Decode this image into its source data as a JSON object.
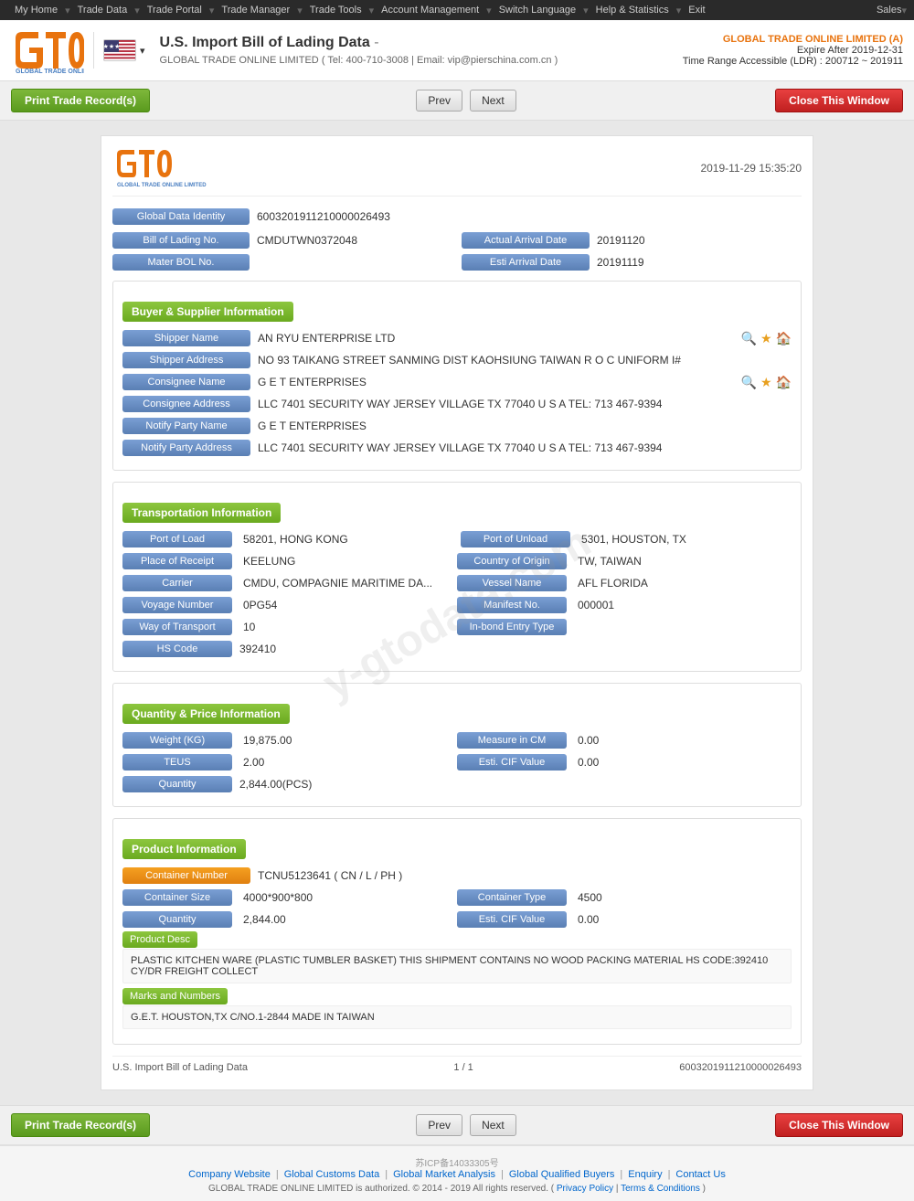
{
  "nav": {
    "items": [
      "My Home",
      "Trade Data",
      "Trade Portal",
      "Trade Manager",
      "Trade Tools",
      "Account Management",
      "Switch Language",
      "Help & Statistics",
      "Exit"
    ],
    "sales": "Sales"
  },
  "header": {
    "title": "U.S. Import Bill of Lading Data",
    "subtitle_company": "GLOBAL TRADE ONLINE LIMITED",
    "subtitle_tel": "Tel: 400-710-3008",
    "subtitle_email": "Email: vip@pierschina.com.cn",
    "company_name": "GLOBAL TRADE ONLINE LIMITED (A)",
    "expire": "Expire After 2019-12-31",
    "ldr": "Time Range Accessible (LDR) : 200712 ~ 201911"
  },
  "actions": {
    "print": "Print Trade Record(s)",
    "prev": "Prev",
    "next": "Next",
    "close": "Close This Window"
  },
  "doc": {
    "date": "2019-11-29 15:35:20",
    "global_data_label": "Global Data Identity",
    "global_data_value": "6003201911210000026493",
    "bol_label": "Bill of Lading No.",
    "bol_value": "CMDUTWN0372048",
    "arrival_date_label": "Actual Arrival Date",
    "arrival_date_value": "20191120",
    "master_bol_label": "Mater BOL No.",
    "master_bol_value": "",
    "esti_arrival_label": "Esti Arrival Date",
    "esti_arrival_value": "20191119"
  },
  "buyer_supplier": {
    "title": "Buyer & Supplier Information",
    "shipper_name_label": "Shipper Name",
    "shipper_name_value": "AN RYU ENTERPRISE LTD",
    "shipper_addr_label": "Shipper Address",
    "shipper_addr_value": "NO 93 TAIKANG STREET SANMING DIST KAOHSIUNG TAIWAN R O C UNIFORM I#",
    "consignee_name_label": "Consignee Name",
    "consignee_name_value": "G E T ENTERPRISES",
    "consignee_addr_label": "Consignee Address",
    "consignee_addr_value": "LLC 7401 SECURITY WAY JERSEY VILLAGE TX 77040 U S A TEL: 713 467-9394",
    "notify_party_name_label": "Notify Party Name",
    "notify_party_name_value": "G E T ENTERPRISES",
    "notify_party_addr_label": "Notify Party Address",
    "notify_party_addr_value": "LLC 7401 SECURITY WAY JERSEY VILLAGE TX 77040 U S A TEL: 713 467-9394"
  },
  "transportation": {
    "title": "Transportation Information",
    "port_load_label": "Port of Load",
    "port_load_value": "58201, HONG KONG",
    "port_unload_label": "Port of Unload",
    "port_unload_value": "5301, HOUSTON, TX",
    "place_receipt_label": "Place of Receipt",
    "place_receipt_value": "KEELUNG",
    "country_origin_label": "Country of Origin",
    "country_origin_value": "TW, TAIWAN",
    "carrier_label": "Carrier",
    "carrier_value": "CMDU, COMPAGNIE MARITIME DA...",
    "vessel_label": "Vessel Name",
    "vessel_value": "AFL FLORIDA",
    "voyage_label": "Voyage Number",
    "voyage_value": "0PG54",
    "manifest_label": "Manifest No.",
    "manifest_value": "000001",
    "way_transport_label": "Way of Transport",
    "way_transport_value": "10",
    "inbond_label": "In-bond Entry Type",
    "inbond_value": "",
    "hs_code_label": "HS Code",
    "hs_code_value": "392410"
  },
  "quantity_price": {
    "title": "Quantity & Price Information",
    "weight_label": "Weight (KG)",
    "weight_value": "19,875.00",
    "measure_label": "Measure in CM",
    "measure_value": "0.00",
    "teus_label": "TEUS",
    "teus_value": "2.00",
    "esti_cif_label": "Esti. CIF Value",
    "esti_cif_value": "0.00",
    "quantity_label": "Quantity",
    "quantity_value": "2,844.00(PCS)"
  },
  "product_info": {
    "title": "Product Information",
    "container_number_label": "Container Number",
    "container_number_value": "TCNU5123641 ( CN / L / PH )",
    "container_size_label": "Container Size",
    "container_size_value": "4000*900*800",
    "container_type_label": "Container Type",
    "container_type_value": "4500",
    "quantity_label": "Quantity",
    "quantity_value": "2,844.00",
    "esti_cif_label": "Esti. CIF Value",
    "esti_cif_value": "0.00",
    "product_desc_label": "Product Desc",
    "product_desc_value": "PLASTIC KITCHEN WARE (PLASTIC TUMBLER BASKET) THIS SHIPMENT CONTAINS NO WOOD PACKING MATERIAL HS CODE:392410 CY/DR FREIGHT COLLECT",
    "marks_label": "Marks and Numbers",
    "marks_value": "G.E.T. HOUSTON,TX C/NO.1-2844 MADE IN TAIWAN"
  },
  "doc_footer": {
    "left": "U.S. Import Bill of Lading Data",
    "center": "1 / 1",
    "right": "6003201911210000026493"
  },
  "footer": {
    "icp": "苏ICP备14033305号",
    "links": [
      "Company Website",
      "Global Customs Data",
      "Global Market Analysis",
      "Global Qualified Buyers",
      "Enquiry",
      "Contact Us"
    ],
    "copy": "GLOBAL TRADE ONLINE LIMITED is authorized. © 2014 - 2019 All rights reserved.",
    "privacy": "Privacy Policy",
    "terms": "Terms & Conditions"
  }
}
